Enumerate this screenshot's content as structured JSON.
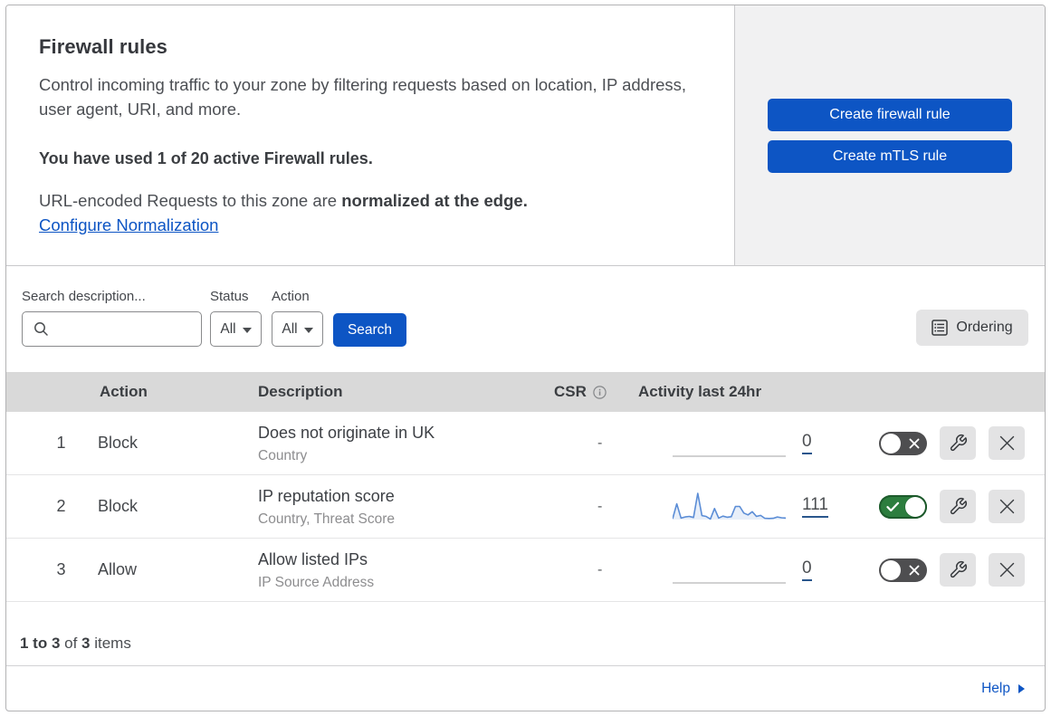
{
  "intro": {
    "title": "Firewall rules",
    "description": "Control incoming traffic to your zone by filtering requests based on location, IP address, user agent, URI, and more.",
    "usage_notice": "You have used 1 of 20 active Firewall rules.",
    "normalization_prefix": "URL-encoded Requests to this zone are ",
    "normalization_bold": "normalized at the edge.",
    "normalization_link": "Configure Normalization"
  },
  "cta": {
    "create_firewall_label": "Create firewall rule",
    "create_mtls_label": "Create mTLS rule"
  },
  "filters": {
    "search_label": "Search description...",
    "search_value": "",
    "status_label": "Status",
    "status_value": "All",
    "action_label": "Action",
    "action_value": "All",
    "search_button_label": "Search",
    "ordering_button_label": "Ordering"
  },
  "table": {
    "headers": {
      "action": "Action",
      "description": "Description",
      "csr": "CSR",
      "activity": "Activity last 24hr"
    },
    "rows": [
      {
        "num": "1",
        "action": "Block",
        "description": "Does not originate in UK",
        "fields": "Country",
        "csr": "-",
        "activity_count": "0",
        "enabled": false,
        "has_sparkline": false
      },
      {
        "num": "2",
        "action": "Block",
        "description": "IP reputation score",
        "fields": "Country, Threat Score",
        "csr": "-",
        "activity_count": "111",
        "enabled": true,
        "has_sparkline": true
      },
      {
        "num": "3",
        "action": "Allow",
        "description": "Allow listed IPs",
        "fields": "IP Source Address",
        "csr": "-",
        "activity_count": "0",
        "enabled": false,
        "has_sparkline": false
      }
    ]
  },
  "chart_data": {
    "type": "area",
    "title": "Activity last 24hr sparkline (rule 2)",
    "x_range_hours": 24,
    "total_requests": 111,
    "values_normalized": [
      0.03,
      0.6,
      0.06,
      0.1,
      0.12,
      0.08,
      1.0,
      0.15,
      0.12,
      0.02,
      0.42,
      0.06,
      0.13,
      0.09,
      0.11,
      0.5,
      0.5,
      0.25,
      0.18,
      0.3,
      0.12,
      0.16,
      0.05,
      0.04,
      0.05,
      0.1,
      0.07,
      0.06
    ],
    "line_color": "#5b8dd6",
    "fill_color": "rgba(91,141,214,0.14)"
  },
  "footer": {
    "range_text": "1 to 3",
    "of_text": " of ",
    "total_text": "3",
    "items_text": " items",
    "help_label": "Help"
  },
  "colors": {
    "accent_blue": "#0d55c4",
    "toggle_on_green": "#2c7d3e",
    "toggle_off_gray": "#4e4e50",
    "header_band": "#d9d9d9",
    "panel_gray": "#f1f1f2"
  }
}
